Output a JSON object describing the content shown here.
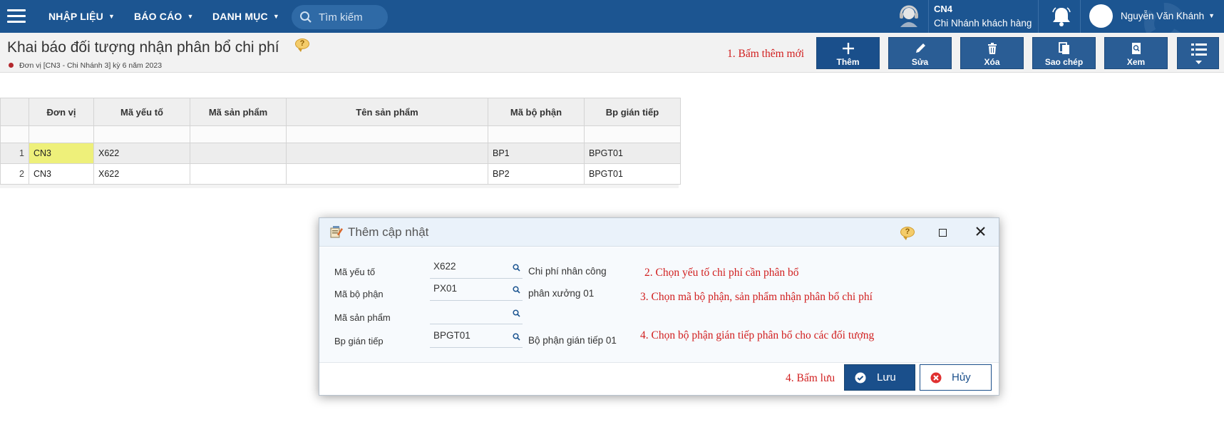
{
  "nav": {
    "menu_items": [
      "NHẬP LIỆU",
      "BÁO CÁO",
      "DANH MỤC"
    ],
    "search_placeholder": "Tìm kiếm",
    "branch_code": "CN4",
    "branch_name": "Chi Nhánh khách hàng",
    "user_name": "Nguyễn Văn Khánh"
  },
  "page": {
    "title": "Khai báo đối tượng nhận phân bổ chi phí",
    "subtitle": "Đơn vị [CN3 - Chi Nhánh 3] kỳ 6 năm 2023",
    "help": "?"
  },
  "toolbar": {
    "hint": "1. Bấm thêm mới",
    "add": "Thêm",
    "edit": "Sửa",
    "delete": "Xóa",
    "copy": "Sao chép",
    "view": "Xem"
  },
  "grid": {
    "columns": [
      "Đơn vị",
      "Mã yếu tố",
      "Mã sản phẩm",
      "Tên sản phẩm",
      "Mã bộ phận",
      "Bp gián tiếp"
    ],
    "rows": [
      {
        "n": "1",
        "cells": [
          "CN3",
          "X622",
          "",
          "",
          "BP1",
          "BPGT01"
        ]
      },
      {
        "n": "2",
        "cells": [
          "CN3",
          "X622",
          "",
          "",
          "BP2",
          "BPGT01"
        ]
      }
    ]
  },
  "dialog": {
    "title": "Thêm cập nhật",
    "help": "?",
    "fields": [
      {
        "label": "Mã yếu tố",
        "value": "X622",
        "desc": "Chi phí nhân công"
      },
      {
        "label": "Mã bộ phận",
        "value": "PX01",
        "desc": "phân xưởng 01"
      },
      {
        "label": "Mã sản phẩm",
        "value": "",
        "desc": ""
      },
      {
        "label": "Bp gián tiếp",
        "value": "BPGT01",
        "desc": "Bộ phận gián tiếp 01"
      }
    ],
    "hints": [
      "2. Chọn yếu tố chi phí cần phân bổ",
      "3. Chọn mã bộ phận, sản phẩm nhận phân bổ chi phí",
      "4. Chọn bộ phận gián tiếp phân bổ cho các đối tượng"
    ],
    "save_hint": "4. Bấm lưu",
    "save": "Lưu",
    "cancel": "Hủy"
  },
  "colors": {
    "nav_bg": "#1c5591",
    "button_bg": "#2a5d95",
    "hint_red": "#d11f1f",
    "selected_cell": "#eef07a"
  }
}
